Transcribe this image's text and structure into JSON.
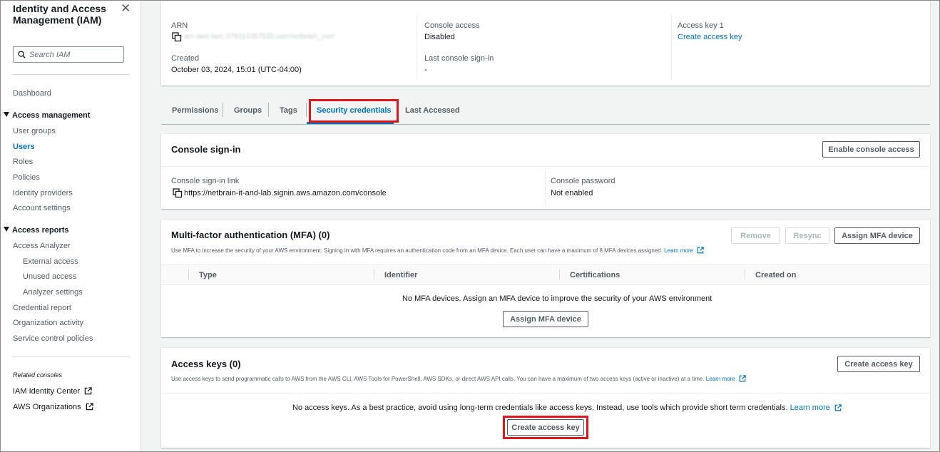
{
  "sidebar": {
    "title": "Identity and Access Management (IAM)",
    "search_placeholder": "Search IAM",
    "dashboard": "Dashboard",
    "access_management": {
      "label": "Access management",
      "items": [
        "User groups",
        "Users",
        "Roles",
        "Policies",
        "Identity providers",
        "Account settings"
      ],
      "active": "Users"
    },
    "access_reports": {
      "label": "Access reports",
      "items": [
        "Access Analyzer",
        "External access",
        "Unused access",
        "Analyzer settings",
        "Credential report",
        "Organization activity",
        "Service control policies"
      ]
    },
    "related_label": "Related consoles",
    "related": [
      "IAM Identity Center",
      "AWS Organizations"
    ]
  },
  "summary": {
    "arn_label": "ARN",
    "arn_value": "arn:aws:iam::076113357035:user/netbrain_user",
    "created_label": "Created",
    "created_value": "October 03, 2024, 15:01 (UTC-04:00)",
    "console_access_label": "Console access",
    "console_access_value": "Disabled",
    "last_signin_label": "Last console sign-in",
    "last_signin_value": "-",
    "access_key_label": "Access key 1",
    "access_key_link": "Create access key"
  },
  "tabs": [
    "Permissions",
    "Groups",
    "Tags",
    "Security credentials",
    "Last Accessed"
  ],
  "active_tab": "Security credentials",
  "console_signin": {
    "title": "Console sign-in",
    "button": "Enable console access",
    "link_label": "Console sign-in link",
    "link_value": "https://netbrain-it-and-lab.signin.aws.amazon.com/console",
    "password_label": "Console password",
    "password_value": "Not enabled"
  },
  "mfa": {
    "title": "Multi-factor authentication (MFA) (0)",
    "description": "Use MFA to increase the security of your AWS environment. Signing in with MFA requires an authentication code from an MFA device. Each user can have a maximum of 8 MFA devices assigned.",
    "learn_more": "Learn more",
    "remove": "Remove",
    "resync": "Resync",
    "assign": "Assign MFA device",
    "columns": [
      "Type",
      "Identifier",
      "Certifications",
      "Created on"
    ],
    "empty_text": "No MFA devices. Assign an MFA device to improve the security of your AWS environment",
    "empty_button": "Assign MFA device"
  },
  "access_keys": {
    "title": "Access keys (0)",
    "description": "Use access keys to send programmatic calls to AWS from the AWS CLI, AWS Tools for PowerShell, AWS SDKs, or direct AWS API calls. You can have a maximum of two access keys (active or inactive) at a time.",
    "learn_more": "Learn more",
    "create_button": "Create access key",
    "empty_text": "No access keys. As a best practice, avoid using long-term credentials like access keys. Instead, use tools which provide short term credentials.",
    "empty_learn_more": "Learn more",
    "empty_button": "Create access key"
  },
  "colors": {
    "link": "#0073bb",
    "highlight": "#e0161f",
    "text": "#16191f",
    "muted": "#545b64"
  },
  "icons": [
    "close-icon",
    "search-icon",
    "copy-icon",
    "external-link-icon",
    "caret-down-icon"
  ]
}
